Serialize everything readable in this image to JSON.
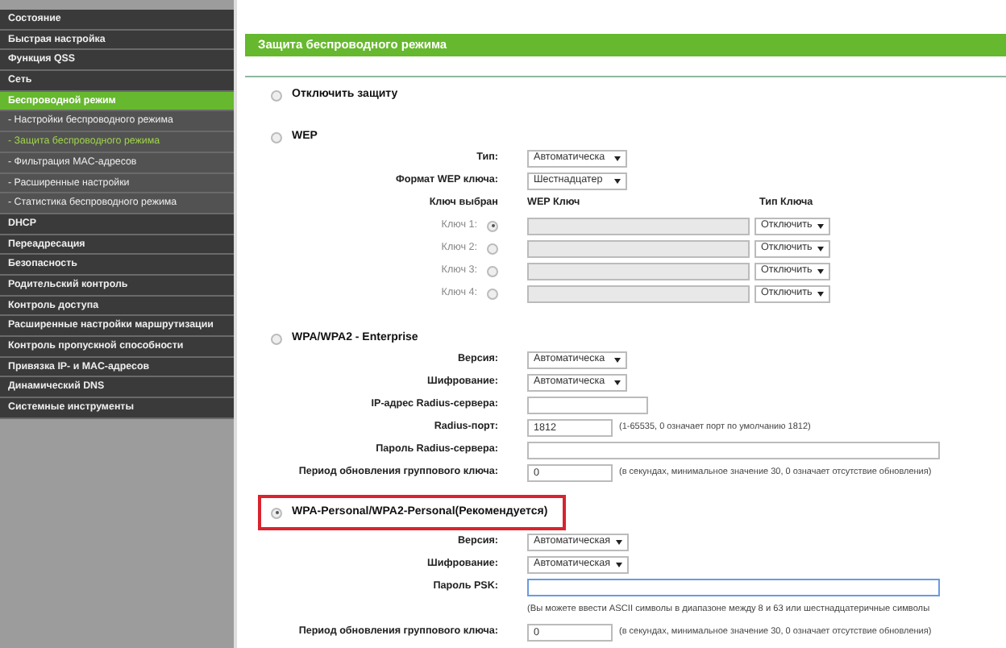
{
  "sidebar": {
    "items": [
      {
        "label": "Состояние",
        "kind": "main",
        "selected": false
      },
      {
        "label": "Быстрая настройка",
        "kind": "main",
        "selected": false
      },
      {
        "label": "Функция QSS",
        "kind": "main",
        "selected": false
      },
      {
        "label": "Сеть",
        "kind": "main",
        "selected": false
      },
      {
        "label": "Беспроводной режим",
        "kind": "main",
        "selected": true
      },
      {
        "label": "- Настройки беспроводного режима",
        "kind": "sub",
        "selected": false
      },
      {
        "label": "- Защита беспроводного режима",
        "kind": "sub",
        "selected": true
      },
      {
        "label": "- Фильтрация MAC-адресов",
        "kind": "sub",
        "selected": false
      },
      {
        "label": "- Расширенные настройки",
        "kind": "sub",
        "selected": false
      },
      {
        "label": "- Статистика беспроводного режима",
        "kind": "sub",
        "selected": false
      },
      {
        "label": "DHCP",
        "kind": "main",
        "selected": false
      },
      {
        "label": "Переадресация",
        "kind": "main",
        "selected": false
      },
      {
        "label": "Безопасность",
        "kind": "main",
        "selected": false
      },
      {
        "label": "Родительский контроль",
        "kind": "main",
        "selected": false
      },
      {
        "label": "Контроль доступа",
        "kind": "main",
        "selected": false
      },
      {
        "label": "Расширенные настройки маршрутизации",
        "kind": "main",
        "selected": false
      },
      {
        "label": "Контроль пропускной способности",
        "kind": "main",
        "selected": false
      },
      {
        "label": "Привязка IP- и MAC-адресов",
        "kind": "main",
        "selected": false
      },
      {
        "label": "Динамический DNS",
        "kind": "main",
        "selected": false
      },
      {
        "label": "Системные инструменты",
        "kind": "main",
        "selected": false
      }
    ]
  },
  "page_title": "Защита беспроводного режима",
  "modes": [
    {
      "label": "Отключить защиту",
      "selected": false
    },
    {
      "label": "WEP",
      "selected": false,
      "fields": [
        {
          "kind": "select",
          "label": "Тип:",
          "value": "Автоматическа"
        },
        {
          "kind": "select",
          "label": "Формат WEP ключа:",
          "value": "Шестнадцатер"
        }
      ],
      "key_table": {
        "disabled": true,
        "columns": [
          "Ключ выбран",
          "WEP Ключ",
          "Тип Ключа"
        ],
        "keys": [
          {
            "label": "Ключ 1:",
            "selected": true,
            "key_type": "Отключить"
          },
          {
            "label": "Ключ 2:",
            "selected": false,
            "key_type": "Отключить"
          },
          {
            "label": "Ключ 3:",
            "selected": false,
            "key_type": "Отключить"
          },
          {
            "label": "Ключ 4:",
            "selected": false,
            "key_type": "Отключить"
          }
        ]
      }
    },
    {
      "label": "WPA/WPA2 - Enterprise",
      "selected": false,
      "fields": [
        {
          "kind": "select",
          "label": "Версия:",
          "value": "Автоматическа"
        },
        {
          "kind": "select",
          "label": "Шифрование:",
          "value": "Автоматическа"
        },
        {
          "kind": "field",
          "label": "IP-адрес Radius-сервера:"
        },
        {
          "kind": "short_field",
          "label": "Radius-порт:",
          "value": "1812",
          "note": "(1-65535, 0 означает порт по умолчанию 1812)"
        },
        {
          "kind": "long_field",
          "label": "Пароль Radius-сервера:"
        },
        {
          "kind": "short_field",
          "label": "Период обновления группового ключа:",
          "value": "0",
          "note": "(в секундах, минимальное значение 30, 0 означает отсутствие обновления)"
        }
      ]
    },
    {
      "label": "WPA-Personal/WPA2-Personal(Рекомендуется)",
      "selected": true,
      "highlighted": true,
      "fields": [
        {
          "kind": "select",
          "label": "Версия:",
          "value": "Автоматическая"
        },
        {
          "kind": "select",
          "label": "Шифрование:",
          "value": "Автоматическая"
        },
        {
          "kind": "long_field",
          "label": "Пароль PSK:",
          "focused": true
        },
        {
          "kind": "hint",
          "text": "(Вы можете ввести ASCII символы в диапазоне между 8 и 63 или шестнадцатеричные символы"
        },
        {
          "kind": "short_field",
          "label": "Период обновления группового ключа:",
          "value": "0",
          "note": "(в секундах, минимальное значение 30, 0 означает отсутствие обновления)"
        }
      ]
    }
  ]
}
